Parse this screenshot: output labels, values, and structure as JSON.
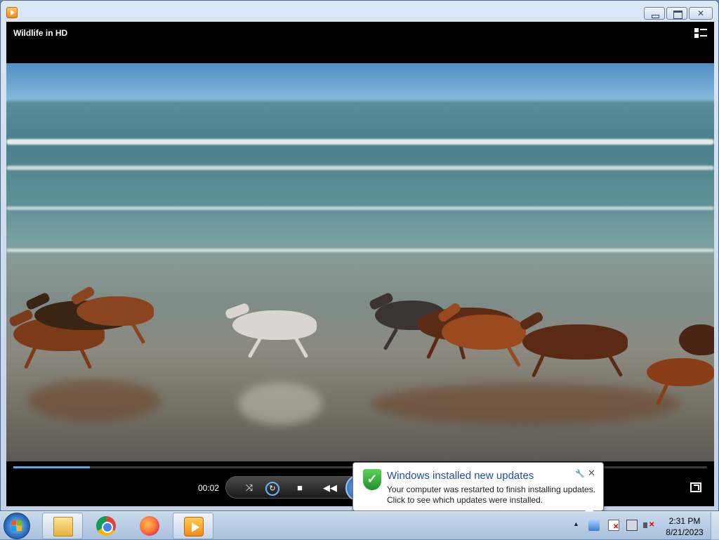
{
  "window": {
    "app_icon": "windows-media-player-icon"
  },
  "player": {
    "video_title": "Wildlife in HD",
    "elapsed_time": "00:02",
    "seek_progress": 0.11,
    "controls": [
      "shuffle-icon",
      "repeat-icon",
      "stop-icon",
      "previous-icon",
      "play-pause-icon"
    ]
  },
  "notification": {
    "title": "Windows installed new updates",
    "line1": "Your computer was restarted to finish installing updates.",
    "line2": "Click to see which updates were installed.",
    "close_glyph": "✕"
  },
  "taskbar": {
    "pinned": [
      "windows-explorer-icon",
      "chrome-icon",
      "firefox-icon",
      "windows-media-player-icon"
    ],
    "clock_time": "2:31 PM",
    "clock_date": "8/21/2023",
    "tray_arrow": "▲"
  },
  "colors": {
    "notification_title": "#1e4fa3",
    "seek_fill": "#5aa6e6"
  }
}
